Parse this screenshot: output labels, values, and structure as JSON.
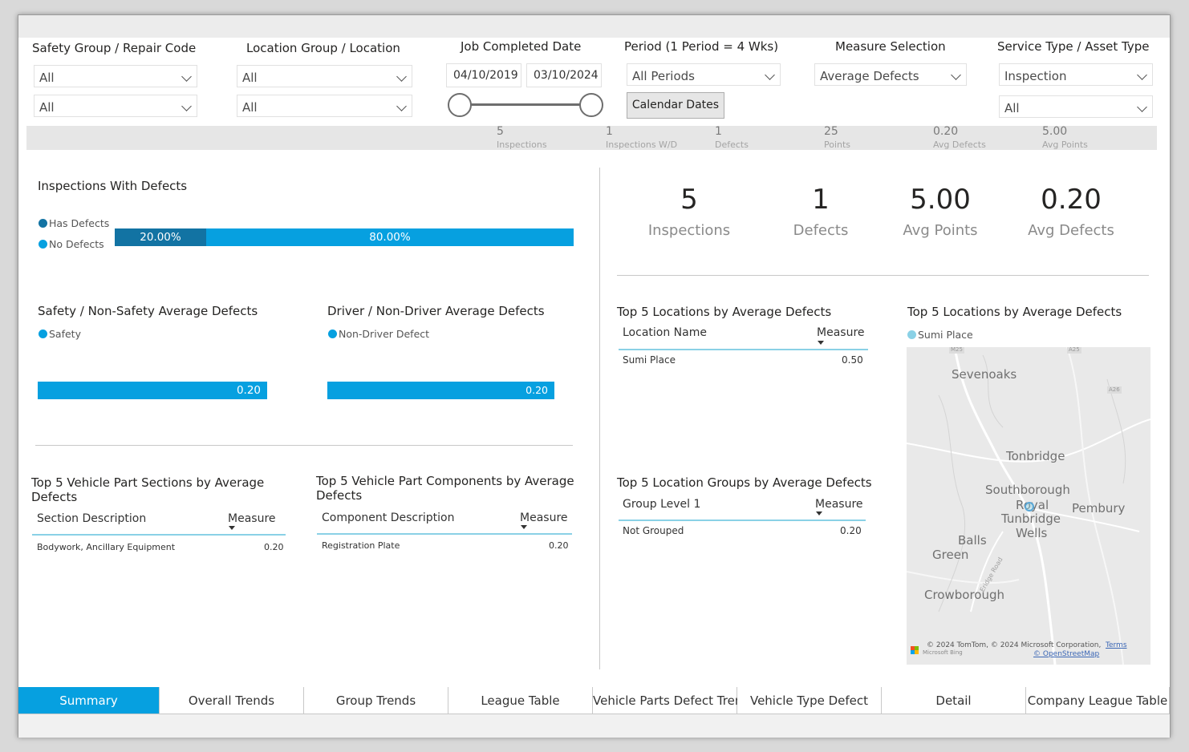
{
  "filters": {
    "safety_group": {
      "label": "Safety Group / Repair Code",
      "value1": "All",
      "value2": "All"
    },
    "location_group": {
      "label": "Location Group / Location",
      "value1": "All",
      "value2": "All"
    },
    "job_date": {
      "label": "Job Completed Date",
      "start": "04/10/2019",
      "end": "03/10/2024"
    },
    "period": {
      "label": "Period (1 Period = 4 Wks)",
      "value": "All Periods",
      "button": "Calendar Dates"
    },
    "measure": {
      "label": "Measure Selection",
      "value": "Average Defects"
    },
    "service_type": {
      "label": "Service Type / Asset Type",
      "value1": "Inspection",
      "value2": "All"
    }
  },
  "kpi_strip": [
    {
      "value": "5",
      "label": "Inspections"
    },
    {
      "value": "1",
      "label": "Inspections W/D"
    },
    {
      "value": "1",
      "label": "Defects"
    },
    {
      "value": "25",
      "label": "Points"
    },
    {
      "value": "0.20",
      "label": "Avg Defects"
    },
    {
      "value": "5.00",
      "label": "Avg Points"
    }
  ],
  "inspections_with_defects": {
    "title": "Inspections With Defects",
    "legend": [
      {
        "label": "Has Defects",
        "color": "#1273a3"
      },
      {
        "label": "No Defects",
        "color": "#06a0e0"
      }
    ],
    "has_label": "20.00%",
    "no_label": "80.00%",
    "has_fraction": 0.2
  },
  "big_kpis": [
    {
      "value": "5",
      "label": "Inspections"
    },
    {
      "value": "1",
      "label": "Defects"
    },
    {
      "value": "5.00",
      "label": "Avg Points"
    },
    {
      "value": "0.20",
      "label": "Avg Defects"
    }
  ],
  "safety_chart": {
    "title": "Safety / Non-Safety Average Defects",
    "legend": "Safety",
    "value": "0.20"
  },
  "driver_chart": {
    "title": "Driver / Non-Driver Average Defects",
    "legend": "Non-Driver Defect",
    "value": "0.20"
  },
  "top_locations_table": {
    "title": "Top 5 Locations by Average Defects",
    "col1": "Location Name",
    "col2": "Measure",
    "rows": [
      {
        "name": "Sumi Place",
        "value": "0.50"
      }
    ]
  },
  "top_locations_map": {
    "title": "Top 5 Locations by Average Defects",
    "legend": "Sumi Place",
    "places": {
      "sevenoaks": "Sevenoaks",
      "tonbridge": "Tonbridge",
      "southborough": "Southborough",
      "royal": "Royal",
      "tunbridge": "Tunbridge",
      "wells": "Wells",
      "pembury": "Pembury",
      "balls": "Balls",
      "green": "Green",
      "crowborough": "Crowborough",
      "road": "Eridge Road",
      "m25": "M25",
      "a25": "A25",
      "a26": "A26"
    },
    "attribution": "© 2024 TomTom, © 2024 Microsoft Corporation,",
    "terms": "Terms",
    "osm": "© OpenStreetMap",
    "bing": "Microsoft Bing"
  },
  "location_groups_table": {
    "title": "Top 5 Location Groups by Average Defects",
    "col1": "Group Level 1",
    "col2": "Measure",
    "rows": [
      {
        "name": "Not Grouped",
        "value": "0.20"
      }
    ]
  },
  "part_sections_table": {
    "title_line1": "Top 5 Vehicle Part Sections by Average",
    "title_line2": "Defects",
    "col1": "Section Description",
    "col2": "Measure",
    "rows": [
      {
        "name": "Bodywork, Ancillary Equipment",
        "value": "0.20"
      }
    ]
  },
  "part_components_table": {
    "title_line1": "Top 5 Vehicle Part Components by Average",
    "title_line2": "Defects",
    "col1": "Component Description",
    "col2": "Measure",
    "rows": [
      {
        "name": "Registration Plate",
        "value": "0.20"
      }
    ]
  },
  "tabs": [
    "Summary",
    "Overall Trends",
    "Group Trends",
    "League Table",
    "Vehicle Parts Defect Trend",
    "Vehicle Type Defect",
    "Detail",
    "Company League Table"
  ],
  "colors": {
    "accent": "#06a0e0",
    "dark": "#1273a3",
    "map_pin": "#5aa7d6"
  }
}
